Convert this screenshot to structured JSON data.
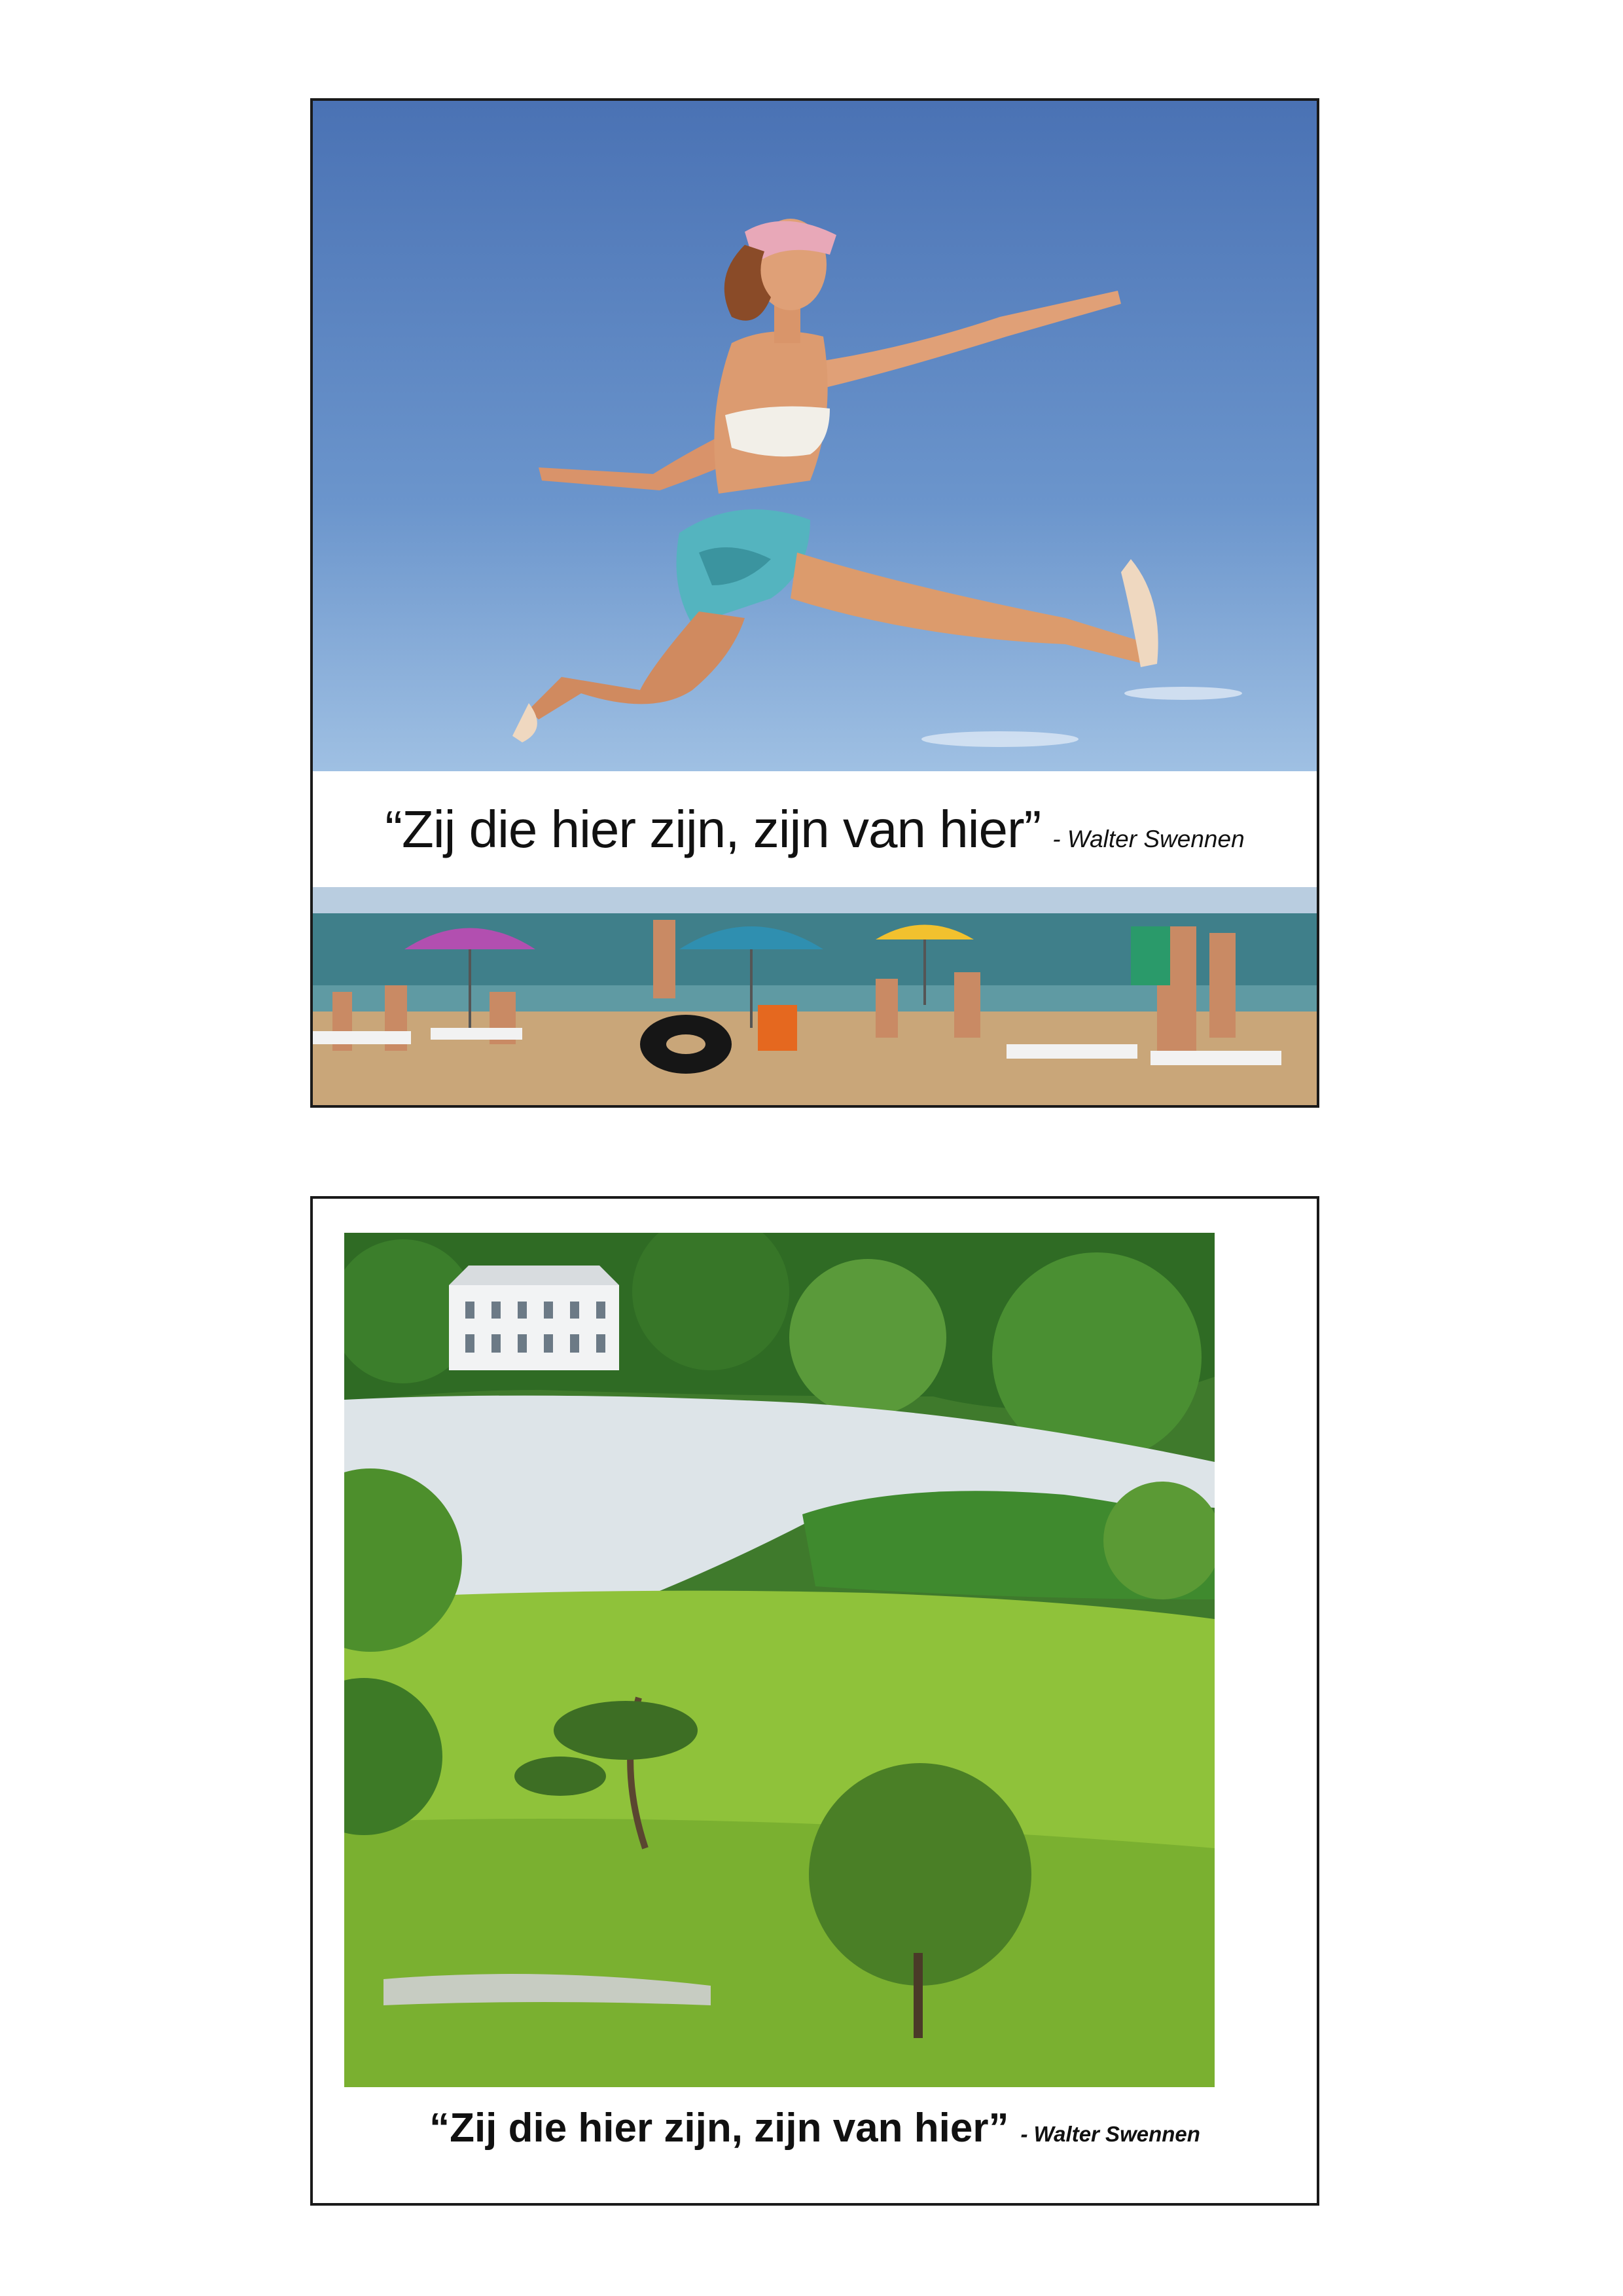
{
  "cards": [
    {
      "quote": "“Zij die hier zijn, zijn van hier”",
      "author": "- Walter Swennen"
    },
    {
      "quote": "“Zij die hier zijn, zijn van hier”",
      "author": "- Walter Swennen"
    }
  ],
  "colors": {
    "border": "#1a1a1a",
    "sky": "#5b86c4",
    "sea": "#3f7f8a",
    "sand": "#c9a679",
    "meadow": "#8fc23a",
    "forest": "#2f6b24",
    "lake": "#dfe6ea"
  },
  "icons": [
    "jumping-woman-photo",
    "beach-crowd-photo",
    "lake-chateau-photo"
  ]
}
